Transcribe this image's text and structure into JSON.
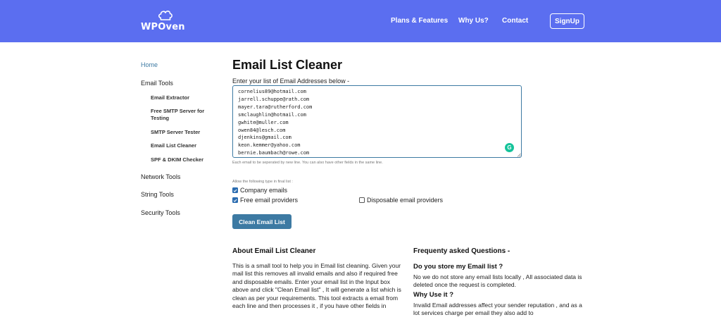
{
  "header": {
    "logo_text": "WPOven",
    "nav": [
      "Plans & Features",
      "Why Us?",
      "Contact"
    ],
    "signup_label": "SignUp",
    "color": "#5b6ef0"
  },
  "sidebar": {
    "items": [
      {
        "label": "Home",
        "level": "top",
        "active": true
      },
      {
        "label": "Email Tools",
        "level": "top"
      },
      {
        "label": "Email Extractor",
        "level": "sub"
      },
      {
        "label": "Free SMTP Server for Testing",
        "level": "sub"
      },
      {
        "label": "SMTP Server Tester",
        "level": "sub"
      },
      {
        "label": "Email List Cleaner",
        "level": "sub"
      },
      {
        "label": "SPF & DKIM Checker",
        "level": "sub"
      },
      {
        "label": "Network Tools",
        "level": "top"
      },
      {
        "label": "String Tools",
        "level": "top"
      },
      {
        "label": "Security Tools",
        "level": "top"
      }
    ]
  },
  "main": {
    "title": "Email List Cleaner",
    "input_label": "Enter your list of Email Addresses below -",
    "emails": [
      "cornelius89@hotmail.com",
      "jarrell.schuppe@rath.com",
      "mayer.tara@rutherford.com",
      "smclaughlin@hotmail.com",
      "gwhite@muller.com",
      "owen84@lesch.com",
      "djenkins@gmail.com",
      "keon.kemmer@yahoo.com",
      "bernie.baumbach@rowe.com"
    ],
    "help_text": "Each email to be seperated by new line. You can also have other fields in the same line.",
    "allow_label": "Allow the following type in final list :",
    "options": {
      "company": {
        "label": "Company emails",
        "checked": true
      },
      "free": {
        "label": "Free email providers",
        "checked": true
      },
      "disposable": {
        "label": "Disposable email providers",
        "checked": false
      }
    },
    "clean_button": "Clean Email List",
    "accent": "#3d7aa3"
  },
  "about": {
    "title": "About Email List Cleaner",
    "body": "This is a small tool to help you in Email list cleaning. Given your mail list this removes all invalid emails and also if required free and disposable emails. Enter your email list in the Input box above and click \"Clean Email list\" , It will generate a list which is clean as per your requirements. This tool extracts a email from each line and then processes it , if you have other fields in"
  },
  "faq": {
    "title": "Frequenty asked Questions -",
    "q1": "Do you store my Email list ?",
    "a1": "No we do not store any email lists locally , All associated data is deleted once the request is completed.",
    "q2": "Why Use it ?",
    "a2": "Invalid Email addresses affect your sender reputation , and as a lot services charge per email they also add to"
  }
}
